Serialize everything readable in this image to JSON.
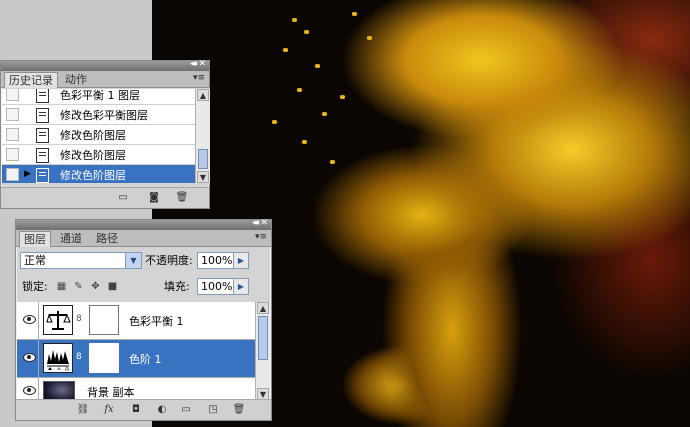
{
  "history_panel": {
    "tabs": [
      "历史记录",
      "动作"
    ],
    "items": [
      {
        "label": "色彩平衡 1 图层",
        "selected": false
      },
      {
        "label": "修改色彩平衡图层",
        "selected": false
      },
      {
        "label": "修改色阶图层",
        "selected": false
      },
      {
        "label": "修改色阶图层",
        "selected": false
      },
      {
        "label": "修改色阶图层",
        "selected": true
      }
    ],
    "footer_icons": [
      "new-document-from-state-icon",
      "new-snapshot-icon",
      "delete-state-icon"
    ]
  },
  "layers_panel": {
    "tabs": [
      "图层",
      "通道",
      "路径"
    ],
    "blend_mode": "正常",
    "opacity_label": "不透明度:",
    "opacity_value": "100%",
    "lock_label": "锁定:",
    "fill_label": "填充:",
    "fill_value": "100%",
    "layers": [
      {
        "name": "色彩平衡 1",
        "type": "adjustment",
        "icon": "balance-scale-icon",
        "visible": true,
        "selected": false
      },
      {
        "name": "色阶 1",
        "type": "adjustment",
        "icon": "levels-histogram-icon",
        "visible": true,
        "selected": true
      },
      {
        "name": "背景 副本",
        "type": "pixel",
        "visible": true,
        "selected": false
      }
    ],
    "footer_icons": [
      "link-layers-icon",
      "layer-style-fx-icon",
      "add-mask-icon",
      "adjustment-layer-icon",
      "new-group-icon",
      "new-layer-icon",
      "delete-layer-icon"
    ]
  },
  "colors": {
    "selection": "#3a72c2",
    "panel_bg": "#d4d4d4",
    "photo_gold": "#f2c51e"
  }
}
